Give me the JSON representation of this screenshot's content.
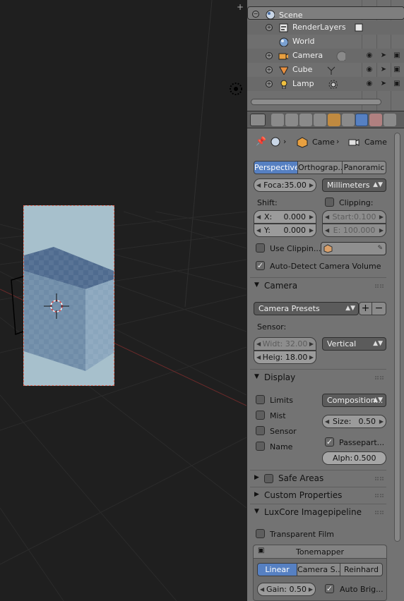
{
  "viewport": {
    "plus_label": "+"
  },
  "outliner": {
    "rows": [
      {
        "label": "Scene",
        "icon": "scene-icon"
      },
      {
        "label": "RenderLayers",
        "icon": "renderlayers-icon"
      },
      {
        "label": "World",
        "icon": "world-icon"
      },
      {
        "label": "Camera",
        "icon": "camera-object-icon"
      },
      {
        "label": "Cube",
        "icon": "mesh-object-icon"
      },
      {
        "label": "Lamp",
        "icon": "lamp-object-icon"
      }
    ]
  },
  "properties": {
    "breadcrumb": {
      "item1": "Came",
      "item2": "Came"
    },
    "lens_type_tabs": [
      "Perspective",
      "Orthograp...",
      "Panoramic"
    ],
    "focal": "Foca:35.00",
    "lens_unit": "Millimeters",
    "shift_label": "Shift:",
    "shift_x_key": "X:",
    "shift_x_val": "0.000",
    "shift_y_key": "Y:",
    "shift_y_val": "0.000",
    "clipping_label": "Clipping:",
    "clip_start": "Start:0.100",
    "clip_end": "E: 100.000",
    "use_clipping": "Use Clippin...",
    "auto_detect": "Auto-Detect Camera Volume",
    "camera_section": "Camera",
    "camera_presets": "Camera Presets",
    "sensor_label": "Sensor:",
    "sensor_width": "Widt: 32.00",
    "sensor_height": "Heig: 18.00",
    "sensor_fit": "Vertical",
    "display_section": "Display",
    "limits": "Limits",
    "mist": "Mist",
    "sensor": "Sensor",
    "name": "Name",
    "composition": "Composition...",
    "size_key": "Size:",
    "size_val": "0.50",
    "passepartout": "Passepart...",
    "alpha_key": "Alph:",
    "alpha_val": "0.500",
    "safe_areas": "Safe Areas",
    "custom_props": "Custom Properties",
    "luxcore_section": "LuxCore Imagepipeline",
    "transparent_film": "Transparent Film",
    "tonemapper": "Tonemapper",
    "tonemap_tabs": [
      "Linear",
      "Camera S...",
      "Reinhard"
    ],
    "gain": "Gain: 0.50",
    "auto_bright": "Auto Brig..."
  },
  "colors": {
    "accent": "#5680c2",
    "frame_border": "#e07060",
    "panel_bg": "#737373"
  }
}
